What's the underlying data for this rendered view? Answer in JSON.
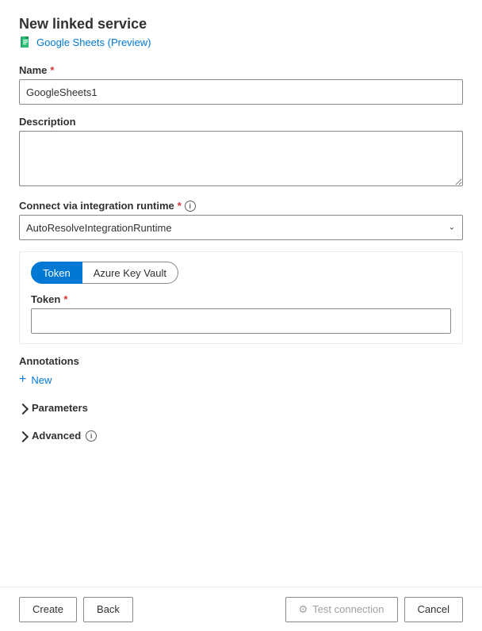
{
  "header": {
    "title": "New linked service",
    "subtitle": "Google Sheets (Preview)"
  },
  "form": {
    "name_label": "Name",
    "name_value": "GoogleSheets1",
    "name_placeholder": "",
    "description_label": "Description",
    "description_placeholder": "",
    "integration_runtime_label": "Connect via integration runtime",
    "integration_runtime_value": "AutoResolveIntegrationRuntime",
    "integration_runtime_options": [
      "AutoResolveIntegrationRuntime"
    ],
    "tab_token": "Token",
    "tab_azure_key_vault": "Azure Key Vault",
    "token_label": "Token",
    "token_placeholder": "",
    "annotations_label": "Annotations",
    "new_button_label": "New",
    "parameters_label": "Parameters",
    "advanced_label": "Advanced"
  },
  "footer": {
    "create_label": "Create",
    "back_label": "Back",
    "test_connection_label": "Test connection",
    "cancel_label": "Cancel"
  },
  "icons": {
    "info": "i",
    "plus": "+",
    "chevron_right": ">",
    "chevron_down": "∨",
    "test_connection_icon": "⚙"
  }
}
